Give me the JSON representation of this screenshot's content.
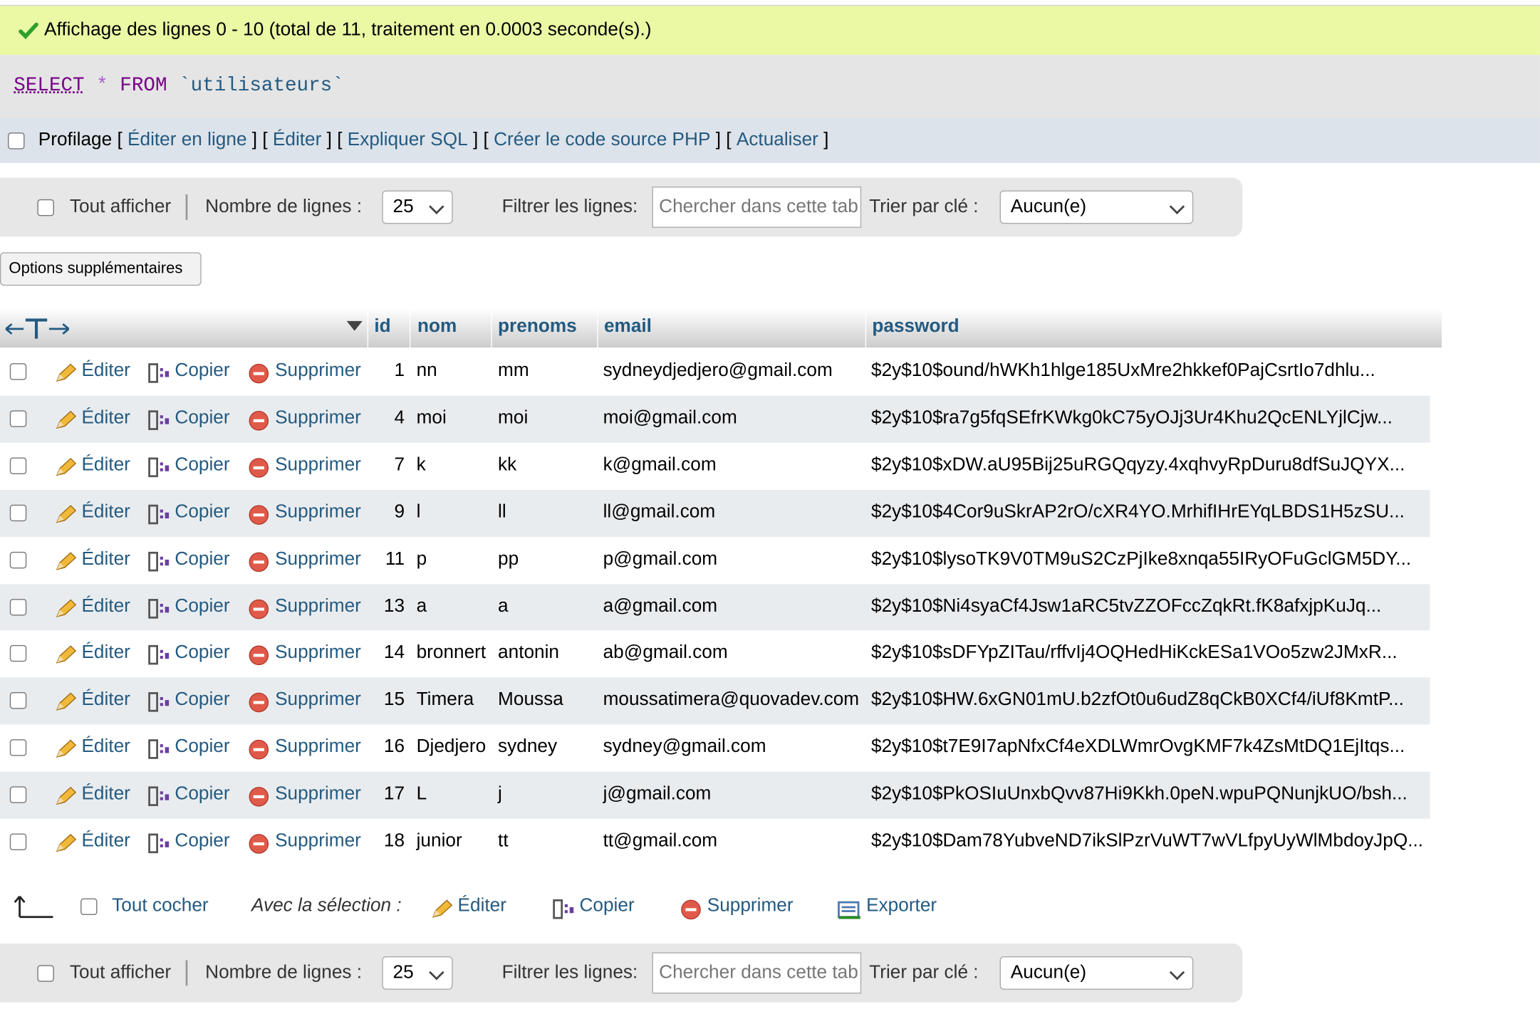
{
  "success_message": "Affichage des lignes 0 - 10 (total de 11, traitement en 0.0003 seconde(s).)",
  "sql": {
    "select": "SELECT",
    "star": "*",
    "from": "FROM",
    "table": "`utilisateurs`"
  },
  "links_bar": {
    "profilage": "Profilage",
    "open": "[",
    "mid": "] [",
    "close": "]",
    "items": [
      "Éditer en ligne",
      "Éditer",
      "Expliquer SQL",
      "Créer le code source PHP",
      "Actualiser"
    ]
  },
  "nav": {
    "show_all": "Tout afficher",
    "row_count_label": "Nombre de lignes :",
    "row_count_value": "25",
    "filter_label": "Filtrer les lignes:",
    "filter_placeholder": "Chercher dans cette tab",
    "sort_label": "Trier par clé :",
    "sort_value": "Aucun(e)"
  },
  "extra_options": "Options supplémentaires",
  "table": {
    "columns": [
      "id",
      "nom",
      "prenoms",
      "email",
      "password"
    ],
    "actions": {
      "edit": "Éditer",
      "copy": "Copier",
      "delete": "Supprimer"
    },
    "rows": [
      {
        "id": "1",
        "nom": "nn",
        "prenoms": "mm",
        "email": "sydneydjedjero@gmail.com",
        "password": "$2y$10$ound/hWKh1hlge185UxMre2hkkef0PajCsrtIo7dhlu..."
      },
      {
        "id": "4",
        "nom": "moi",
        "prenoms": "moi",
        "email": "moi@gmail.com",
        "password": "$2y$10$ra7g5fqSEfrKWkg0kC75yOJj3Ur4Khu2QcENLYjlCjw..."
      },
      {
        "id": "7",
        "nom": "k",
        "prenoms": "kk",
        "email": "k@gmail.com",
        "password": "$2y$10$xDW.aU95Bij25uRGQqyzy.4xqhvyRpDuru8dfSuJQYX..."
      },
      {
        "id": "9",
        "nom": "l",
        "prenoms": "ll",
        "email": "ll@gmail.com",
        "password": "$2y$10$4Cor9uSkrAP2rO/cXR4YO.MrhifIHrEYqLBDS1H5zSU..."
      },
      {
        "id": "11",
        "nom": "p",
        "prenoms": "pp",
        "email": "p@gmail.com",
        "password": "$2y$10$lysoTK9V0TM9uS2CzPjIke8xnqa55IRyOFuGclGM5DY..."
      },
      {
        "id": "13",
        "nom": "a",
        "prenoms": "a",
        "email": "a@gmail.com",
        "password": "$2y$10$Ni4syaCf4Jsw1aRC5tvZZOFccZqkRt.fK8afxjpKuJq..."
      },
      {
        "id": "14",
        "nom": "bronnert",
        "prenoms": "antonin",
        "email": "ab@gmail.com",
        "password": "$2y$10$sDFYpZITau/rffvIj4OQHedHiKckESa1VOo5zw2JMxR..."
      },
      {
        "id": "15",
        "nom": "Timera",
        "prenoms": "Moussa",
        "email": "moussatimera@quovadev.com",
        "password": "$2y$10$HW.6xGN01mU.b2zfOt0u6udZ8qCkB0XCf4/iUf8KmtP..."
      },
      {
        "id": "16",
        "nom": "Djedjero",
        "prenoms": "sydney",
        "email": "sydney@gmail.com",
        "password": "$2y$10$t7E9I7apNfxCf4eXDLWmrOvgKMF7k4ZsMtDQ1EjItqs..."
      },
      {
        "id": "17",
        "nom": "L",
        "prenoms": "j",
        "email": "j@gmail.com",
        "password": "$2y$10$PkOSIuUnxbQvv87Hi9Kkh.0peN.wpuPQNunjkUO/bsh..."
      },
      {
        "id": "18",
        "nom": "junior",
        "prenoms": "tt",
        "email": "tt@gmail.com",
        "password": "$2y$10$Dam78YubveND7ikSlPzrVuWT7wVLfpyUyWlMbdoyJpQ..."
      }
    ]
  },
  "bulk": {
    "check_all": "Tout cocher",
    "with_selection": "Avec la sélection :",
    "edit": "Éditer",
    "copy": "Copier",
    "delete": "Supprimer",
    "export": "Exporter"
  },
  "colors": {
    "success_bg": "#ebf8a4",
    "link": "#235a81",
    "row_even": "#e9ecef"
  }
}
